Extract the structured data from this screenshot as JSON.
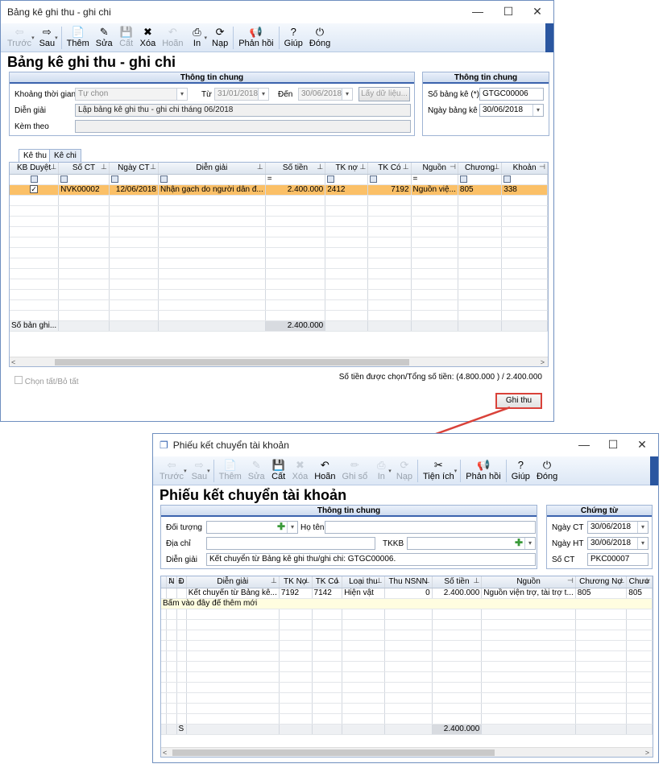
{
  "win1": {
    "title": "Bảng kê ghi thu - ghi chi",
    "controls": {
      "min": "—",
      "max": "☐",
      "close": "✕"
    },
    "toolbar": [
      {
        "label": "Trước",
        "icon": "arrow-left-icon",
        "glyph": "⇦",
        "disabled": true
      },
      {
        "label": "Sau",
        "icon": "arrow-right-icon",
        "glyph": "⇨",
        "disabled": false
      },
      {
        "label": "Thêm",
        "icon": "add-document-icon",
        "glyph": "📄",
        "disabled": false
      },
      {
        "label": "Sửa",
        "icon": "edit-document-icon",
        "glyph": "✎",
        "disabled": false
      },
      {
        "label": "Cất",
        "icon": "save-icon",
        "glyph": "💾",
        "disabled": true
      },
      {
        "label": "Xóa",
        "icon": "delete-icon",
        "glyph": "✖",
        "disabled": false
      },
      {
        "label": "Hoãn",
        "icon": "undo-icon",
        "glyph": "↶",
        "disabled": true
      },
      {
        "label": "In",
        "icon": "printer-icon",
        "glyph": "⎙",
        "disabled": false
      },
      {
        "label": "Nạp",
        "icon": "refresh-icon",
        "glyph": "⟳",
        "disabled": false
      },
      {
        "label": "Phản hồi",
        "icon": "megaphone-icon",
        "glyph": "📢",
        "disabled": false
      },
      {
        "label": "Giúp",
        "icon": "help-icon",
        "glyph": "?",
        "disabled": false
      },
      {
        "label": "Đóng",
        "icon": "power-icon",
        "glyph": "⏻",
        "disabled": false
      }
    ],
    "page_title": "Bảng kê ghi thu - ghi chi",
    "general": {
      "header": "Thông tin chung",
      "period_label": "Khoảng thời gian",
      "period_value": "Tự chọn",
      "from_label": "Từ",
      "from_value": "31/01/2018",
      "to_label": "Đến",
      "to_value": "30/06/2018",
      "fetch_button": "Lấy dữ liệu...",
      "desc_label": "Diễn giải",
      "desc_value": "Lập bảng kê ghi thu - ghi chi tháng 06/2018",
      "attach_label": "Kèm theo",
      "attach_value": ""
    },
    "general2": {
      "header": "Thông tin chung",
      "no_label": "Số bảng kê (*)",
      "no_value": "GTGC00006",
      "date_label": "Ngày bảng kê",
      "date_value": "30/06/2018"
    },
    "tabs": [
      "Kê thu",
      "Kê chi"
    ],
    "columns": [
      "KB Duyệt",
      "Số CT",
      "Ngày CT",
      "Diễn giải",
      "Số tiền",
      "TK nợ",
      "TK Có",
      "Nguồn",
      "Chương",
      "Khoản"
    ],
    "filter_eq": "=",
    "rows": [
      {
        "checked": "✓",
        "so_ct": "NVK00002",
        "ngay_ct": "12/06/2018",
        "dien_giai": "Nhận gạch do người dân đ...",
        "so_tien": "2.400.000",
        "tk_no": "2412",
        "tk_co": "7192",
        "nguon": "Nguồn việ...",
        "chuong": "805",
        "khoan": "338"
      }
    ],
    "summary_label": "Số bản ghi...",
    "summary_total": "2.400.000",
    "select_all": "Chọn tất/Bỏ tất",
    "status": "Số tiền được chọn/Tổng số tiền: (4.800.000 ) / 2.400.000",
    "ghi_thu": "Ghi thu"
  },
  "win2": {
    "title": "Phiếu kết chuyển tài khoản",
    "controls": {
      "min": "—",
      "max": "☐",
      "close": "✕"
    },
    "toolbar": [
      {
        "label": "Trước",
        "icon": "arrow-left-icon",
        "glyph": "⇦",
        "disabled": true
      },
      {
        "label": "Sau",
        "icon": "arrow-right-icon",
        "glyph": "⇨",
        "disabled": true
      },
      {
        "label": "Thêm",
        "icon": "add-document-icon",
        "glyph": "📄",
        "disabled": true
      },
      {
        "label": "Sửa",
        "icon": "edit-document-icon",
        "glyph": "✎",
        "disabled": true
      },
      {
        "label": "Cất",
        "icon": "save-icon",
        "glyph": "💾",
        "disabled": false
      },
      {
        "label": "Xóa",
        "icon": "delete-icon",
        "glyph": "✖",
        "disabled": true
      },
      {
        "label": "Hoãn",
        "icon": "undo-icon",
        "glyph": "↶",
        "disabled": false
      },
      {
        "label": "Ghi sổ",
        "icon": "pencil-icon",
        "glyph": "✏",
        "disabled": true
      },
      {
        "label": "In",
        "icon": "printer-icon",
        "glyph": "⎙",
        "disabled": true
      },
      {
        "label": "Nạp",
        "icon": "refresh-icon",
        "glyph": "⟳",
        "disabled": true
      },
      {
        "label": "Tiện ích",
        "icon": "tools-icon",
        "glyph": "✂",
        "disabled": false
      },
      {
        "label": "Phản hồi",
        "icon": "megaphone-icon",
        "glyph": "📢",
        "disabled": false
      },
      {
        "label": "Giúp",
        "icon": "help-icon",
        "glyph": "?",
        "disabled": false
      },
      {
        "label": "Đóng",
        "icon": "power-icon",
        "glyph": "⏻",
        "disabled": false
      }
    ],
    "page_title": "Phiếu kết chuyển tài khoản",
    "general": {
      "header": "Thông tin chung",
      "obj_label": "Đối tượng",
      "name_label": "Họ tên",
      "addr_label": "Địa chỉ",
      "tkkb_label": "TKKB",
      "desc_label": "Diễn giải",
      "desc_value": "Kết chuyển từ Bảng kê ghi thu/ghi chi: GTGC00006."
    },
    "voucher": {
      "header": "Chứng từ",
      "date_ct_label": "Ngày CT",
      "date_ct_value": "30/06/2018",
      "date_ht_label": "Ngày HT",
      "date_ht_value": "30/06/2018",
      "no_label": "Số CT",
      "no_value": "PKC00007"
    },
    "columns": [
      "N",
      "Đ",
      "Diễn giải",
      "TK Nợ",
      "TK Có",
      "Loại thu",
      "Thu NSNN",
      "Số tiền",
      "Nguồn",
      "Chương Nợ",
      "Chươ"
    ],
    "rows": [
      {
        "dien_giai": "Kết chuyển từ Bảng kê...",
        "tk_no": "7192",
        "tk_co": "7142",
        "loai_thu": "Hiện vật",
        "thu_nsnn": "0",
        "so_tien": "2.400.000",
        "nguon": "Nguồn viện trợ, tài trợ t...",
        "chuong_no": "805",
        "chuong": "805"
      }
    ],
    "add_row": "Bấm vào đây để thêm mới",
    "summary_s": "S",
    "summary_total": "2.400.000"
  },
  "arrow_color": "#d9423a"
}
